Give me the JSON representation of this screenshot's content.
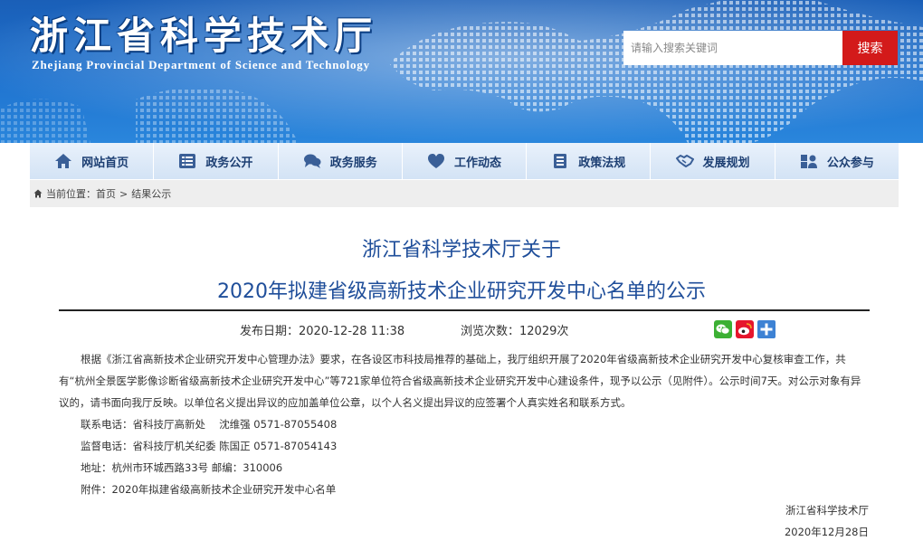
{
  "header": {
    "site_title": "浙江省科学技术厅",
    "site_subtitle": "Zhejiang Provincial Department of Science and Technology",
    "search_placeholder": "请输入搜索关键词",
    "search_button": "搜索"
  },
  "nav": {
    "items": [
      {
        "label": "网站首页",
        "icon": "home-icon"
      },
      {
        "label": "政务公开",
        "icon": "list-icon"
      },
      {
        "label": "政务服务",
        "icon": "chat-bubbles-icon"
      },
      {
        "label": "工作动态",
        "icon": "heart-icon"
      },
      {
        "label": "政策法规",
        "icon": "document-icon"
      },
      {
        "label": "发展规划",
        "icon": "handshake-icon"
      },
      {
        "label": "公众参与",
        "icon": "people-icon"
      }
    ]
  },
  "breadcrumb": {
    "prefix": "当前位置：",
    "items": [
      "首页",
      "结果公示"
    ],
    "separator": ">"
  },
  "article": {
    "title_line1": "浙江省科学技术厅关于",
    "title_line2": "2020年拟建省级高新技术企业研究开发中心名单的公示",
    "publish_date": "发布日期：2020-12-28 11:38",
    "view_count": "浏览次数：12029次",
    "share_icons": [
      "wechat-icon",
      "weibo-icon",
      "plus-share-icon"
    ],
    "paragraph": "根据《浙江省高新技术企业研究开发中心管理办法》要求，在各设区市科技局推荐的基础上，我厅组织开展了2020年省级高新技术企业研究开发中心复核审查工作，共有“杭州全景医学影像诊断省级高新技术企业研究开发中心”等721家单位符合省级高新技术企业研究开发中心建设条件，现予以公示（见附件）。公示时间7天。对公示对象有异议的，请书面向我厅反映。以单位名义提出异议的应加盖单位公章，以个人名义提出异议的应签署个人真实姓名和联系方式。",
    "contact": "联系电话：省科技厅高新处　 沈维强 0571-87055408",
    "supervision": "监督电话：省科技厅机关纪委  陈国正 0571-87054143",
    "address": "地址：杭州市环城西路33号   邮编：310006",
    "attachment": "附件：2020年拟建省级高新技术企业研究开发中心名单",
    "signature_org": "浙江省科学技术厅",
    "signature_date": "2020年12月28日"
  },
  "colors": {
    "banner_blue": "#1f73cf",
    "search_red": "#d31a1a",
    "title_blue": "#1f4e9a",
    "nav_text": "#1d3f73"
  }
}
